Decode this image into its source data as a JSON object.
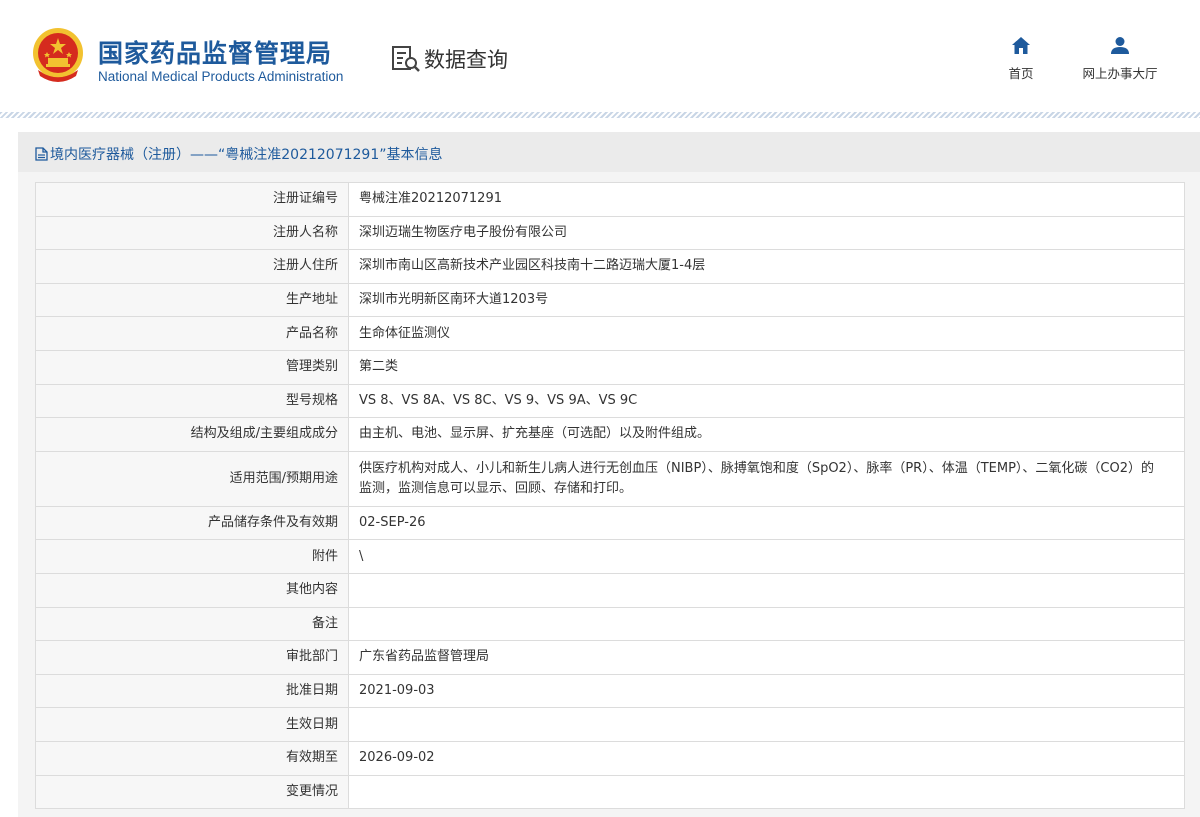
{
  "header": {
    "logo_cn": "国家药品监督管理局",
    "logo_en": "National Medical Products Administration",
    "section_title": "数据查询",
    "nav": [
      {
        "label": "首页",
        "icon": "home-icon"
      },
      {
        "label": "网上办事大厅",
        "icon": "user-icon"
      }
    ],
    "colors": {
      "brand": "#1e5a9c",
      "emblem_red": "#d52b1e",
      "emblem_gold": "#f2c230"
    }
  },
  "panel": {
    "title": "境内医疗器械（注册）——“粤械注准20212071291”基本信息"
  },
  "rows": [
    {
      "label": "注册证编号",
      "value": "粤械注准20212071291"
    },
    {
      "label": "注册人名称",
      "value": "深圳迈瑞生物医疗电子股份有限公司"
    },
    {
      "label": "注册人住所",
      "value": "深圳市南山区高新技术产业园区科技南十二路迈瑞大厦1-4层"
    },
    {
      "label": "生产地址",
      "value": "深圳市光明新区南环大道1203号"
    },
    {
      "label": "产品名称",
      "value": "生命体征监测仪"
    },
    {
      "label": "管理类别",
      "value": "第二类"
    },
    {
      "label": "型号规格",
      "value": "VS 8、VS 8A、VS 8C、VS 9、VS 9A、VS 9C"
    },
    {
      "label": "结构及组成/主要组成成分",
      "value": "由主机、电池、显示屏、扩充基座（可选配）以及附件组成。"
    },
    {
      "label": "适用范围/预期用途",
      "value": "供医疗机构对成人、小儿和新生儿病人进行无创血压（NIBP）、脉搏氧饱和度（SpO2）、脉率（PR）、体温（TEMP）、二氧化碳（CO2）的监测，监测信息可以显示、回顾、存储和打印。"
    },
    {
      "label": "产品储存条件及有效期",
      "value": "02-SEP-26"
    },
    {
      "label": "附件",
      "value": "\\"
    },
    {
      "label": "其他内容",
      "value": ""
    },
    {
      "label": "备注",
      "value": ""
    },
    {
      "label": "审批部门",
      "value": "广东省药品监督管理局"
    },
    {
      "label": "批准日期",
      "value": "2021-09-03"
    },
    {
      "label": "生效日期",
      "value": ""
    },
    {
      "label": "有效期至",
      "value": "2026-09-02"
    },
    {
      "label": "变更情况",
      "value": ""
    }
  ]
}
